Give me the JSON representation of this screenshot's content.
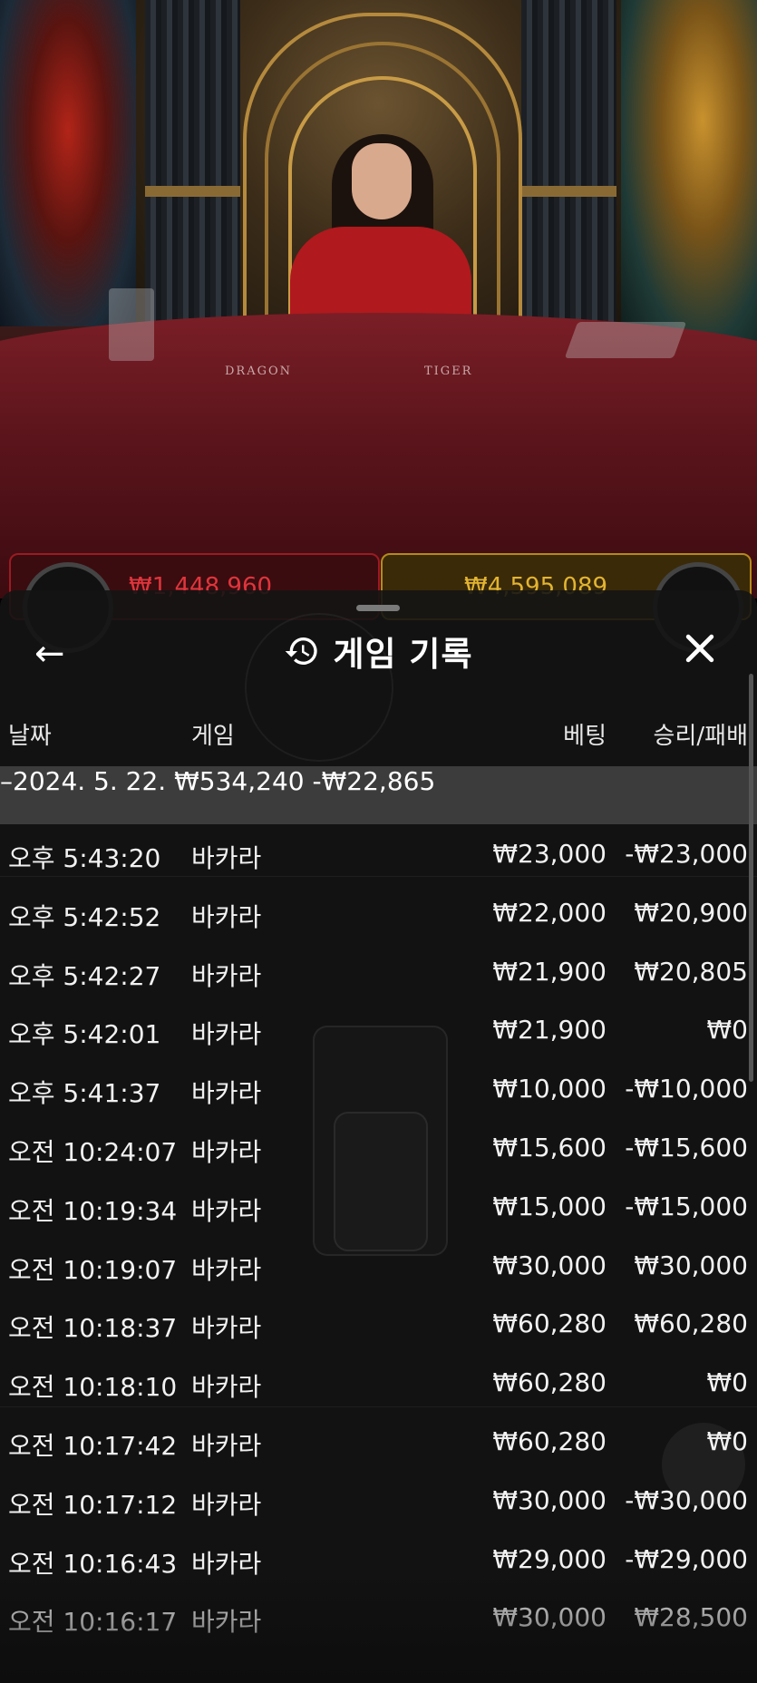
{
  "scene": {
    "table_words": [
      "DRAGON",
      "TIGER"
    ],
    "left_bet_amount": "₩1,448,960",
    "right_bet_amount": "₩4,595,089"
  },
  "sheet": {
    "title": "게임 기록",
    "back_icon": "←",
    "history_icon": "history-icon",
    "close_icon": "close-icon",
    "columns": {
      "date": "날짜",
      "game": "게임",
      "bet": "베팅",
      "result": "승리/패배"
    },
    "date_group": {
      "date": "–2024. 5. 22.",
      "bet": "₩534,240",
      "result": "-₩22,865"
    },
    "rows": [
      {
        "time": "오후 5:43:20",
        "game": "바카라",
        "bet": "₩23,000",
        "result": "-₩23,000"
      },
      {
        "time": "오후 5:42:52",
        "game": "바카라",
        "bet": "₩22,000",
        "result": "₩20,900"
      },
      {
        "time": "오후 5:42:27",
        "game": "바카라",
        "bet": "₩21,900",
        "result": "₩20,805"
      },
      {
        "time": "오후 5:42:01",
        "game": "바카라",
        "bet": "₩21,900",
        "result": "₩0"
      },
      {
        "time": "오후 5:41:37",
        "game": "바카라",
        "bet": "₩10,000",
        "result": "-₩10,000"
      },
      {
        "time": "오전 10:24:07",
        "game": "바카라",
        "bet": "₩15,600",
        "result": "-₩15,600"
      },
      {
        "time": "오전 10:19:34",
        "game": "바카라",
        "bet": "₩15,000",
        "result": "-₩15,000"
      },
      {
        "time": "오전 10:19:07",
        "game": "바카라",
        "bet": "₩30,000",
        "result": "₩30,000"
      },
      {
        "time": "오전 10:18:37",
        "game": "바카라",
        "bet": "₩60,280",
        "result": "₩60,280"
      },
      {
        "time": "오전 10:18:10",
        "game": "바카라",
        "bet": "₩60,280",
        "result": "₩0"
      },
      {
        "time": "오전 10:17:42",
        "game": "바카라",
        "bet": "₩60,280",
        "result": "₩0"
      },
      {
        "time": "오전 10:17:12",
        "game": "바카라",
        "bet": "₩30,000",
        "result": "-₩30,000"
      },
      {
        "time": "오전 10:16:43",
        "game": "바카라",
        "bet": "₩29,000",
        "result": "-₩29,000"
      },
      {
        "time": "오전 10:16:17",
        "game": "바카라",
        "bet": "₩30,000",
        "result": "₩28,500"
      }
    ]
  }
}
